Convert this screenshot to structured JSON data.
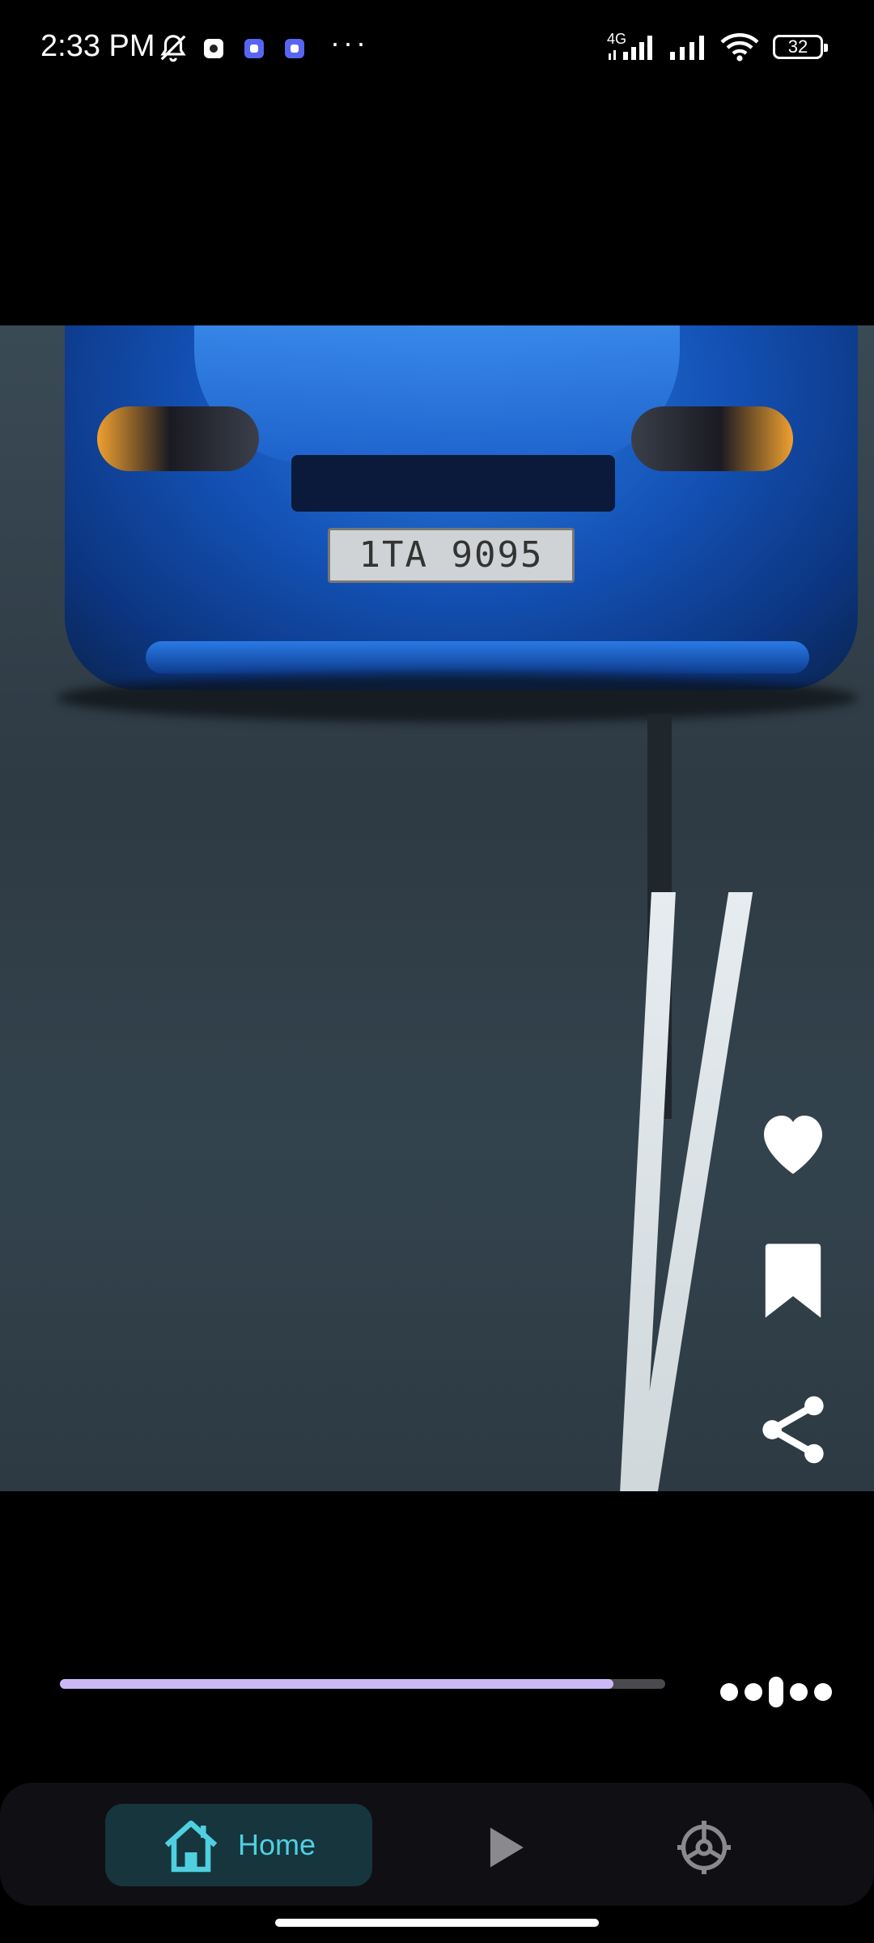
{
  "status_bar": {
    "time": "2:33 PM",
    "network_label": "4G",
    "battery": "32",
    "more": "···"
  },
  "video": {
    "plate_text": "1TA 9095"
  },
  "actions": {
    "like_icon": "heart-icon",
    "bookmark_icon": "bookmark-icon",
    "share_icon": "share-icon"
  },
  "player": {
    "progress_fraction": 0.915
  },
  "bottom_nav": {
    "items": [
      {
        "label": "Home",
        "icon": "home-icon",
        "active": true
      },
      {
        "label": "",
        "icon": "play-icon",
        "active": false
      },
      {
        "label": "",
        "icon": "settings-icon",
        "active": false
      }
    ]
  },
  "colors": {
    "accent": "#4fd0e0",
    "progress": "#cbb8f5",
    "nav_active_bg": "#16353d"
  }
}
